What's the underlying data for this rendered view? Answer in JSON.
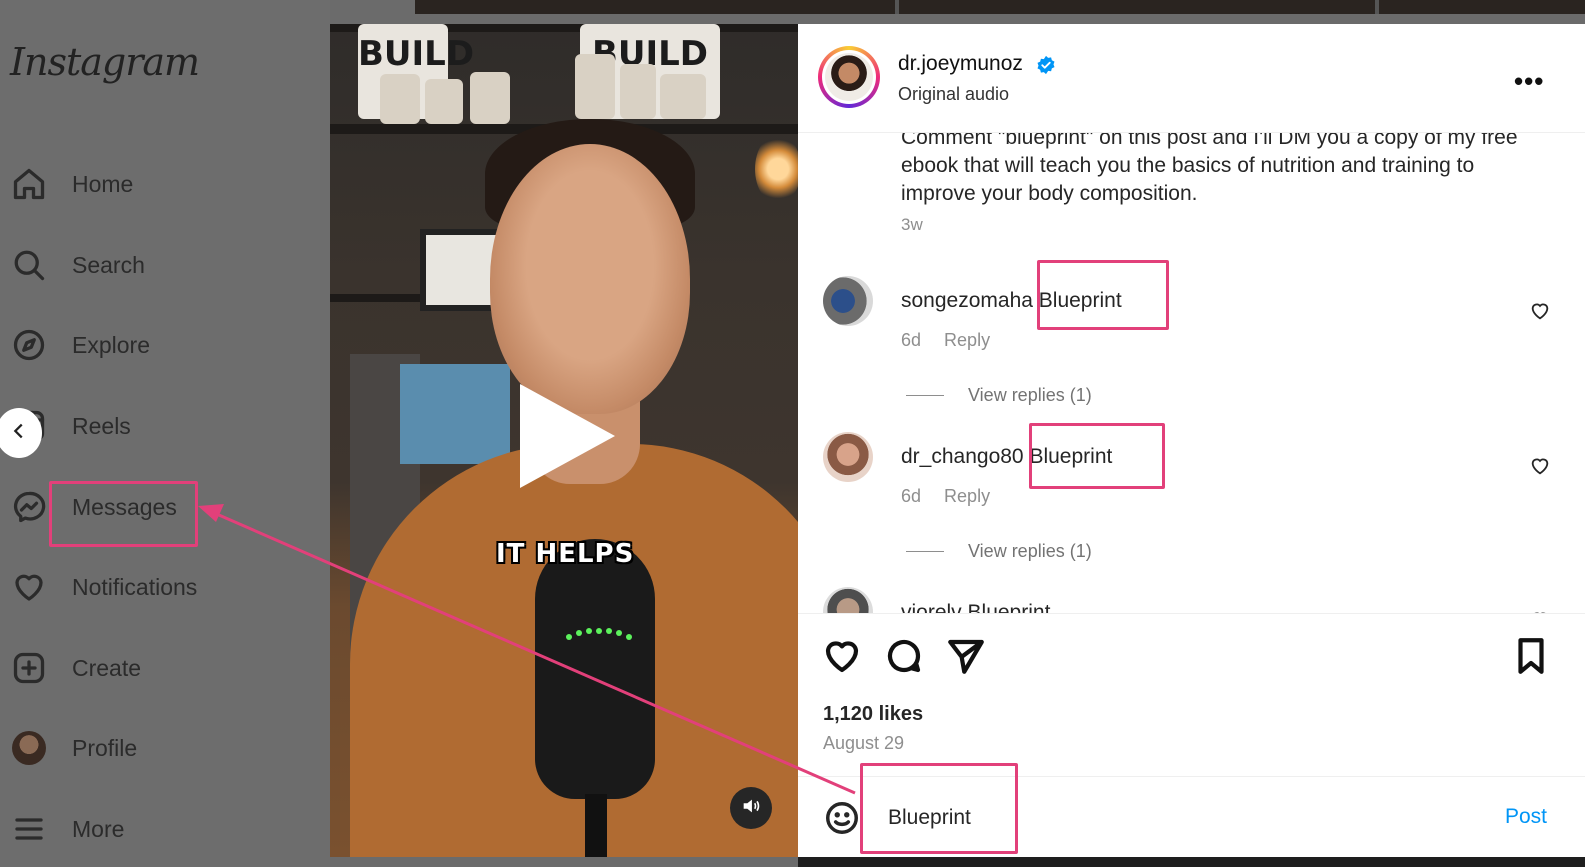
{
  "app": {
    "name": "Instagram",
    "accent_color": "#0095f6",
    "annotation_color": "#e2407a"
  },
  "sidebar": {
    "items": [
      {
        "label": "Home",
        "icon": "home-icon"
      },
      {
        "label": "Search",
        "icon": "search-icon"
      },
      {
        "label": "Explore",
        "icon": "compass-icon"
      },
      {
        "label": "Reels",
        "icon": "reels-icon"
      },
      {
        "label": "Messages",
        "icon": "messenger-icon"
      },
      {
        "label": "Notifications",
        "icon": "heart-icon"
      },
      {
        "label": "Create",
        "icon": "plus-square-icon"
      },
      {
        "label": "Profile",
        "icon": "avatar"
      },
      {
        "label": "More",
        "icon": "hamburger-icon"
      }
    ]
  },
  "video": {
    "caption": "IT HELPS",
    "bag_text": "BUILD"
  },
  "post": {
    "username": "dr.joeymunoz",
    "audio": "Original audio",
    "caption": "Comment \"blueprint\" on this post and I'll DM you a copy of my free ebook that will teach you the basics of nutrition and training to improve your body composition.",
    "age": "3w",
    "comments": [
      {
        "user": "songezomaha",
        "text": "Blueprint",
        "age": "6d",
        "reply": "Reply",
        "view_replies": "View replies (1)"
      },
      {
        "user": "dr_chango80",
        "text": "Blueprint",
        "age": "6d",
        "reply": "Reply",
        "view_replies": "View replies (1)"
      },
      {
        "user": "viorelv",
        "text": "Blueprint"
      }
    ],
    "likes": "1,120 likes",
    "date": "August 29",
    "comment_input_value": "Blueprint",
    "post_button": "Post",
    "more_icon": "more-horizontal-icon"
  }
}
